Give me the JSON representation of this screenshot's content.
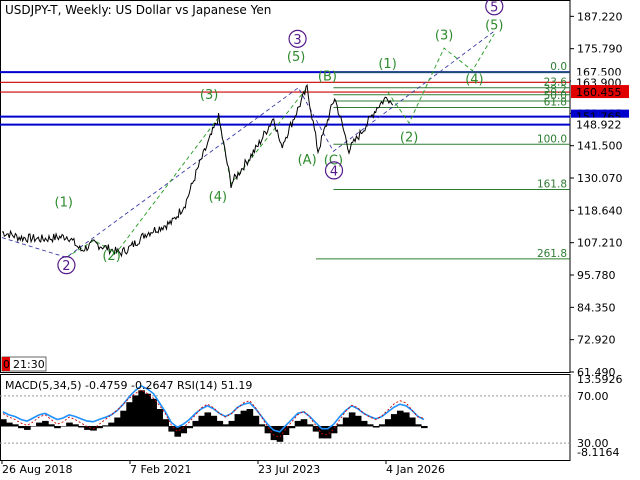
{
  "header": {
    "title": "USDJPY-T, Weekly:  US Dollar vs Japanese Yen"
  },
  "colors": {
    "price": "#000000",
    "wave_green": "#2e8b2e",
    "wave_purple": "#551a8b",
    "level_blue": "#0000cc",
    "level_red": "#cc0000",
    "macd_blue": "#1e90ff",
    "macd_hist": "#000000",
    "rsi_red": "#cc0000",
    "grid": "#c0c0c0",
    "price_badge_red": "#e00000",
    "price_badge_blue": "#0000cc"
  },
  "chart_data": [
    {
      "type": "line",
      "series": [
        {
          "values": [
            {
              "x": "2018-08-26",
              "y": 111.0
            },
            {
              "x": "2019-01-01",
              "y": 109.0
            },
            {
              "x": "2019-06-01",
              "y": 108.5
            },
            {
              "x": "2019-12-01",
              "y": 109.5
            },
            {
              "x": "2020-03-01",
              "y": 104.5
            },
            {
              "x": "2020-06-01",
              "y": 107.0
            },
            {
              "x": "2020-12-01",
              "y": 103.5
            },
            {
              "x": "2021-02-07",
              "y": 105.5
            },
            {
              "x": "2021-06-01",
              "y": 110.5
            },
            {
              "x": "2021-12-01",
              "y": 114.5
            },
            {
              "x": "2022-03-01",
              "y": 121.0
            },
            {
              "x": "2022-06-01",
              "y": 134.0
            },
            {
              "x": "2022-10-20",
              "y": 151.5
            },
            {
              "x": "2023-01-15",
              "y": 128.0
            },
            {
              "x": "2023-07-23",
              "y": 141.5
            },
            {
              "x": "2023-11-10",
              "y": 151.5
            },
            {
              "x": "2024-01-01",
              "y": 141.0
            },
            {
              "x": "2024-07-01",
              "y": 161.9
            },
            {
              "x": "2024-09-15",
              "y": 139.6
            },
            {
              "x": "2025-01-10",
              "y": 158.5
            },
            {
              "x": "2025-04-20",
              "y": 140.0
            },
            {
              "x": "2025-08-01",
              "y": 147.5
            },
            {
              "x": "2025-11-01",
              "y": 155.0
            },
            {
              "x": "2026-01-15",
              "y": 159.0
            },
            {
              "x": "2026-02-20",
              "y": 155.8
            }
          ]
        }
      ],
      "xticks": [
        "26 Aug 2018",
        "7 Feb 2021",
        "23 Jul 2023",
        "4 Jan 2026"
      ],
      "yticks": [
        187.22,
        175.79,
        164.36,
        152.935,
        141.5,
        130.07,
        118.64,
        107.21,
        95.78,
        84.35,
        72.92,
        61.49
      ],
      "ylim": [
        61.49,
        193.0
      ],
      "levels": [
        {
          "price": 167.5,
          "label": "167.500",
          "kind": "blue"
        },
        {
          "price": 163.9,
          "label": "163.900",
          "kind": "red"
        },
        {
          "price": 160.455,
          "label": "160.455",
          "kind": "red_badge"
        },
        {
          "price": 151.765,
          "label": "151.765",
          "kind": "blue_badge"
        },
        {
          "price": 148.922,
          "label": "148.922",
          "kind": "blue"
        }
      ],
      "fibonacci": [
        {
          "label": "0.0",
          "price": 167.5
        },
        {
          "label": "23.6",
          "price": 162.0
        },
        {
          "label": "38.2",
          "price": 159.5
        },
        {
          "label": "50.0",
          "price": 157.3
        },
        {
          "label": "61.8",
          "price": 155.0
        },
        {
          "label": "100.0",
          "price": 142.0
        },
        {
          "label": "161.8",
          "price": 126.0
        },
        {
          "label": "261.8",
          "price": 101.5
        }
      ],
      "wave_labels": [
        {
          "text": "(1)",
          "x": "2019-11-01",
          "y": 120.0,
          "color": "green",
          "circle": false
        },
        {
          "text": "2",
          "x": "2019-11-20",
          "y": 97.5,
          "color": "purple",
          "circle": true
        },
        {
          "text": "(2)",
          "x": "2020-10-01",
          "y": 101.0,
          "color": "green",
          "circle": false
        },
        {
          "text": "(3)",
          "x": "2022-08-15",
          "y": 158.0,
          "color": "green",
          "circle": false
        },
        {
          "text": "(4)",
          "x": "2022-10-15",
          "y": 122.0,
          "color": "green",
          "circle": false
        },
        {
          "text": "(5)",
          "x": "2024-04-15",
          "y": 171.5,
          "color": "green",
          "circle": false
        },
        {
          "text": "3",
          "x": "2024-04-25",
          "y": 177.5,
          "color": "purple",
          "circle": true
        },
        {
          "text": "(A)",
          "x": "2024-07-01",
          "y": 135.0,
          "color": "green",
          "circle": false
        },
        {
          "text": "(B)",
          "x": "2024-11-20",
          "y": 164.5,
          "color": "green",
          "circle": false
        },
        {
          "text": "(C)",
          "x": "2025-01-01",
          "y": 134.8,
          "color": "green",
          "circle": false
        },
        {
          "text": "4",
          "x": "2025-01-05",
          "y": 131.0,
          "color": "purple",
          "circle": true
        },
        {
          "text": "(1)",
          "x": "2026-01-15",
          "y": 169.0,
          "color": "green",
          "circle": false
        },
        {
          "text": "(2)",
          "x": "2026-06-15",
          "y": 143.0,
          "color": "green",
          "circle": false
        },
        {
          "text": "(3)",
          "x": "2027-02-15",
          "y": 179.0,
          "color": "green",
          "circle": false
        },
        {
          "text": "(4)",
          "x": "2027-09-15",
          "y": 163.5,
          "color": "green",
          "circle": false
        },
        {
          "text": "(5)",
          "x": "2028-02-01",
          "y": 182.5,
          "color": "green",
          "circle": false
        },
        {
          "text": "5",
          "x": "2028-02-01",
          "y": 189.0,
          "color": "purple",
          "circle": true
        }
      ],
      "wave_paths": [
        {
          "style": "purple_dash",
          "points": [
            {
              "x": "2018-08-26",
              "y": 109.0
            },
            {
              "x": "2019-11-20",
              "y": 102.0
            },
            {
              "x": "2024-05-01",
              "y": 162.0
            },
            {
              "x": "2025-01-01",
              "y": 139.5
            },
            {
              "x": "2028-02-01",
              "y": 182.0
            }
          ]
        },
        {
          "style": "green_dash",
          "points": [
            {
              "x": "2019-11-20",
              "y": 102.0
            },
            {
              "x": "2020-06-01",
              "y": 108.0
            },
            {
              "x": "2020-11-01",
              "y": 103.5
            },
            {
              "x": "2022-10-20",
              "y": 151.5
            },
            {
              "x": "2023-01-15",
              "y": 128.0
            },
            {
              "x": "2024-07-01",
              "y": 162.0
            }
          ]
        },
        {
          "style": "green_dash",
          "points": [
            {
              "x": "2026-01-15",
              "y": 160.5
            },
            {
              "x": "2026-06-15",
              "y": 149.5
            },
            {
              "x": "2027-02-15",
              "y": 176.0
            },
            {
              "x": "2027-09-01",
              "y": 168.0
            },
            {
              "x": "2028-02-01",
              "y": 181.0
            }
          ]
        }
      ]
    },
    {
      "type": "area",
      "title": "MACD(5,34,5) -0.4759 -0.2647 RSI(14) 51.19",
      "yticks": [
        "13.5926",
        "70.00",
        "30.00",
        "-8.1164"
      ],
      "series": [
        {
          "name": "MACD",
          "values": [
            2,
            1,
            0.5,
            -0.5,
            -1,
            0,
            1,
            1.5,
            0.5,
            -0.5,
            0,
            1,
            0.5,
            -0.3,
            -1,
            -1.2,
            -0.5,
            0.2,
            1,
            2.5,
            4.5,
            7,
            9,
            10.5,
            9.5,
            8,
            5,
            2,
            -1.5,
            -3,
            -2,
            -0.5,
            1.5,
            3,
            4,
            3,
            1.5,
            0.5,
            1.5,
            3.5,
            4.5,
            5,
            3,
            0.5,
            -2,
            -4,
            -4.5,
            -2.5,
            -0.5,
            1.5,
            2,
            0.5,
            -1.5,
            -3.5,
            -3.5,
            -2,
            0.5,
            2.5,
            4,
            3,
            1.5,
            0.5,
            -0.3,
            0.5,
            2,
            3.5,
            4.5,
            4,
            2.5,
            0.5,
            -0.4759
          ]
        },
        {
          "name": "RSI",
          "values": [
            55,
            52,
            50,
            47,
            45,
            48,
            52,
            54,
            50,
            46,
            48,
            52,
            50,
            47,
            44,
            42,
            46,
            50,
            54,
            58,
            63,
            68,
            72,
            75,
            72,
            68,
            62,
            55,
            45,
            40,
            43,
            48,
            54,
            60,
            63,
            60,
            55,
            52,
            55,
            60,
            64,
            66,
            60,
            52,
            44,
            37,
            35,
            42,
            48,
            54,
            57,
            52,
            45,
            38,
            37,
            42,
            50,
            57,
            62,
            60,
            55,
            52,
            50,
            53,
            58,
            63,
            66,
            64,
            58,
            52,
            51.19
          ]
        }
      ]
    }
  ],
  "time_badge": {
    "prefix": "0",
    "time": "21:30"
  }
}
